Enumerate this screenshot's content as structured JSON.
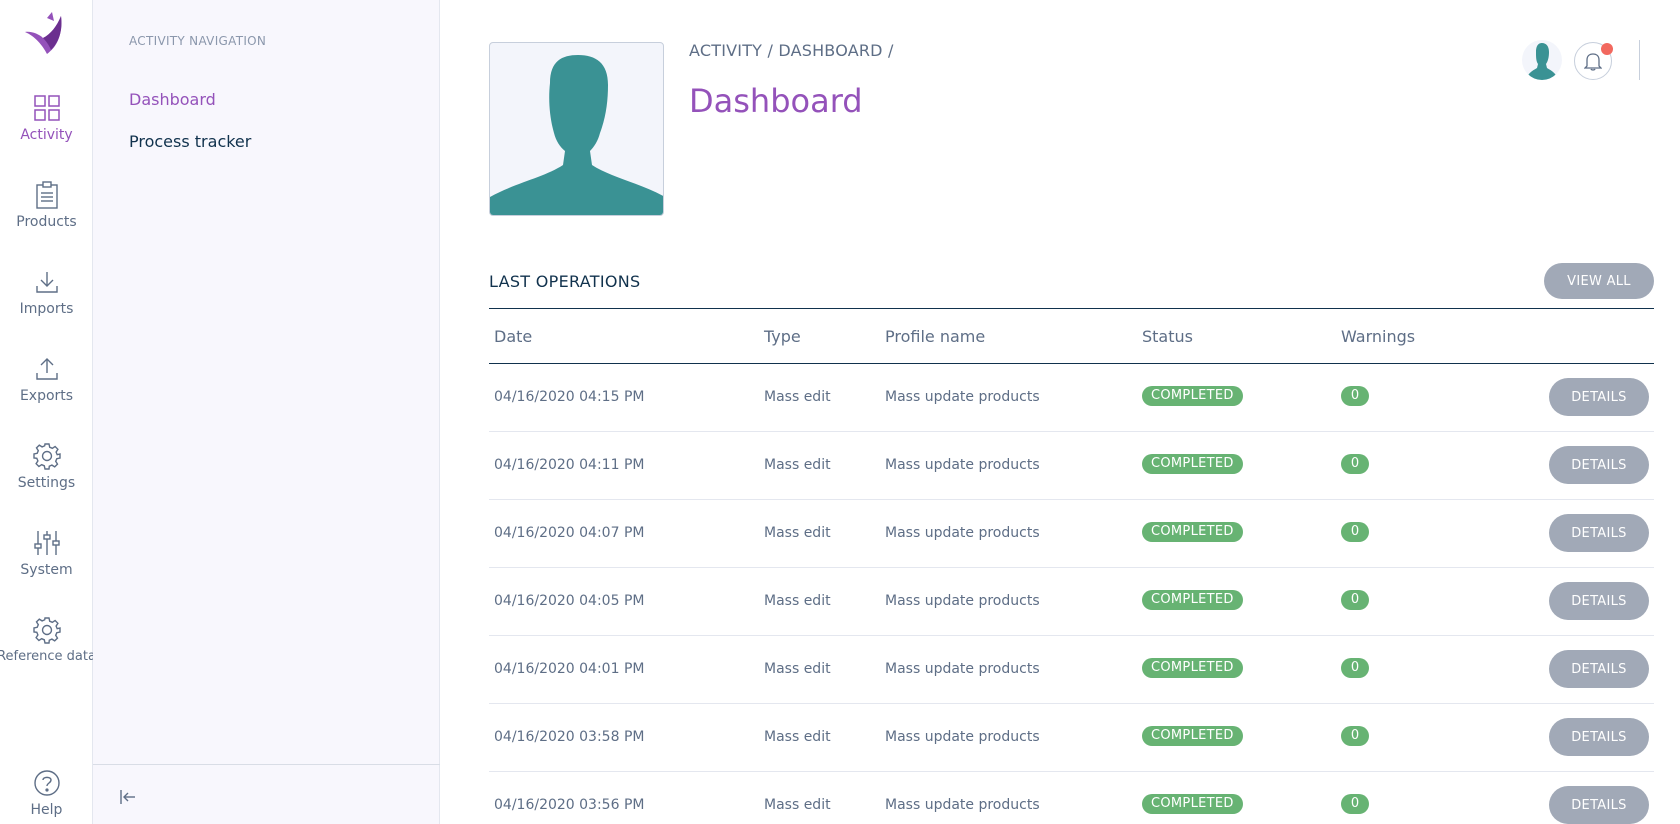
{
  "colors": {
    "brand": "#9452ba",
    "text": "#11324d",
    "muted": "#5e6e86",
    "success": "#67b373",
    "button_grey": "#a1a9b7",
    "notification": "#f2685e",
    "avatar": "#3a9294"
  },
  "rail": {
    "items": [
      {
        "label": "Activity",
        "icon": "grid-icon",
        "active": true
      },
      {
        "label": "Products",
        "icon": "clipboard-icon"
      },
      {
        "label": "Imports",
        "icon": "download-icon"
      },
      {
        "label": "Exports",
        "icon": "upload-icon"
      },
      {
        "label": "Settings",
        "icon": "gear-icon"
      },
      {
        "label": "System",
        "icon": "sliders-icon"
      },
      {
        "label": "Reference data",
        "icon": "gear-icon"
      }
    ],
    "help_label": "Help"
  },
  "subnav": {
    "title": "ACTIVITY NAVIGATION",
    "links": [
      {
        "label": "Dashboard",
        "active": true
      },
      {
        "label": "Process tracker"
      }
    ]
  },
  "header": {
    "breadcrumb": [
      "ACTIVITY",
      "DASHBOARD"
    ],
    "separator": "/",
    "title": "Dashboard"
  },
  "operations": {
    "title": "LAST OPERATIONS",
    "view_all_label": "VIEW ALL",
    "columns": [
      "Date",
      "Type",
      "Profile name",
      "Status",
      "Warnings"
    ],
    "details_label": "DETAILS",
    "rows": [
      {
        "date": "04/16/2020 04:15 PM",
        "type": "Mass edit",
        "profile": "Mass update products",
        "status": "COMPLETED",
        "warnings": "0"
      },
      {
        "date": "04/16/2020 04:11 PM",
        "type": "Mass edit",
        "profile": "Mass update products",
        "status": "COMPLETED",
        "warnings": "0"
      },
      {
        "date": "04/16/2020 04:07 PM",
        "type": "Mass edit",
        "profile": "Mass update products",
        "status": "COMPLETED",
        "warnings": "0"
      },
      {
        "date": "04/16/2020 04:05 PM",
        "type": "Mass edit",
        "profile": "Mass update products",
        "status": "COMPLETED",
        "warnings": "0"
      },
      {
        "date": "04/16/2020 04:01 PM",
        "type": "Mass edit",
        "profile": "Mass update products",
        "status": "COMPLETED",
        "warnings": "0"
      },
      {
        "date": "04/16/2020 03:58 PM",
        "type": "Mass edit",
        "profile": "Mass update products",
        "status": "COMPLETED",
        "warnings": "0"
      },
      {
        "date": "04/16/2020 03:56 PM",
        "type": "Mass edit",
        "profile": "Mass update products",
        "status": "COMPLETED",
        "warnings": "0"
      }
    ]
  }
}
